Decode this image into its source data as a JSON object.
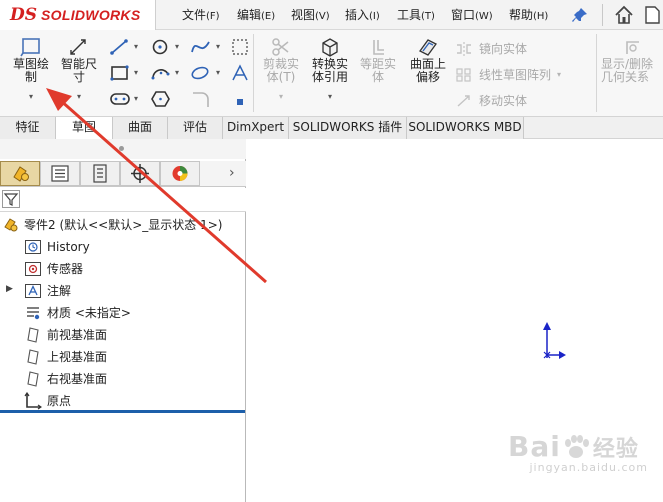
{
  "app": {
    "logo_ds": "DS",
    "logo_text": "SOLIDWORKS"
  },
  "menu": [
    {
      "label": "文件",
      "accel": "(F)"
    },
    {
      "label": "编辑",
      "accel": "(E)"
    },
    {
      "label": "视图",
      "accel": "(V)"
    },
    {
      "label": "插入",
      "accel": "(I)"
    },
    {
      "label": "工具",
      "accel": "(T)"
    },
    {
      "label": "窗口",
      "accel": "(W)"
    },
    {
      "label": "帮助",
      "accel": "(H)"
    }
  ],
  "ribbon": {
    "sketch_l1": "草图绘",
    "sketch_l2": "制",
    "smart_dim_l1": "智能尺",
    "smart_dim_l2": "寸",
    "trim_l1": "剪裁实",
    "trim_l2": "体(T)",
    "convert_l1": "转换实",
    "convert_l2": "体引用",
    "offset_dist_l1": "等距实",
    "offset_dist_l2": "体",
    "offset_surface_l1": "曲面上",
    "offset_surface_l2": "偏移",
    "mirror": "镜向实体",
    "linear_pattern": "线性草图阵列",
    "move": "移动实体",
    "show_hide_l1": "显示/删除",
    "show_hide_l2": "几何关系"
  },
  "tabs": [
    "特征",
    "草图",
    "曲面",
    "评估",
    "DimXpert",
    "SOLIDWORKS 插件",
    "SOLIDWORKS MBD"
  ],
  "active_tab": "草图",
  "tree": {
    "root": "零件2 (默认<<默认>_显示状态 1>)",
    "items": [
      {
        "label": "History",
        "icon": "history-icon"
      },
      {
        "label": "传感器",
        "icon": "sensor-icon"
      },
      {
        "label": "注解",
        "icon": "annotation-icon",
        "expandable": true
      },
      {
        "label": "材质 <未指定>",
        "icon": "material-icon"
      },
      {
        "label": "前视基准面",
        "icon": "plane-icon"
      },
      {
        "label": "上视基准面",
        "icon": "plane-icon"
      },
      {
        "label": "右视基准面",
        "icon": "plane-icon"
      },
      {
        "label": "原点",
        "icon": "origin-icon"
      }
    ]
  },
  "watermark": {
    "text": "Bai",
    "text2": "经验",
    "sub": "jingyan.baidu.com"
  },
  "colors": {
    "accent_red": "#d42020",
    "arrow_red": "#e03a2c",
    "tree_selection_line": "#1d5faa",
    "origin_blue": "#1a23c7"
  }
}
